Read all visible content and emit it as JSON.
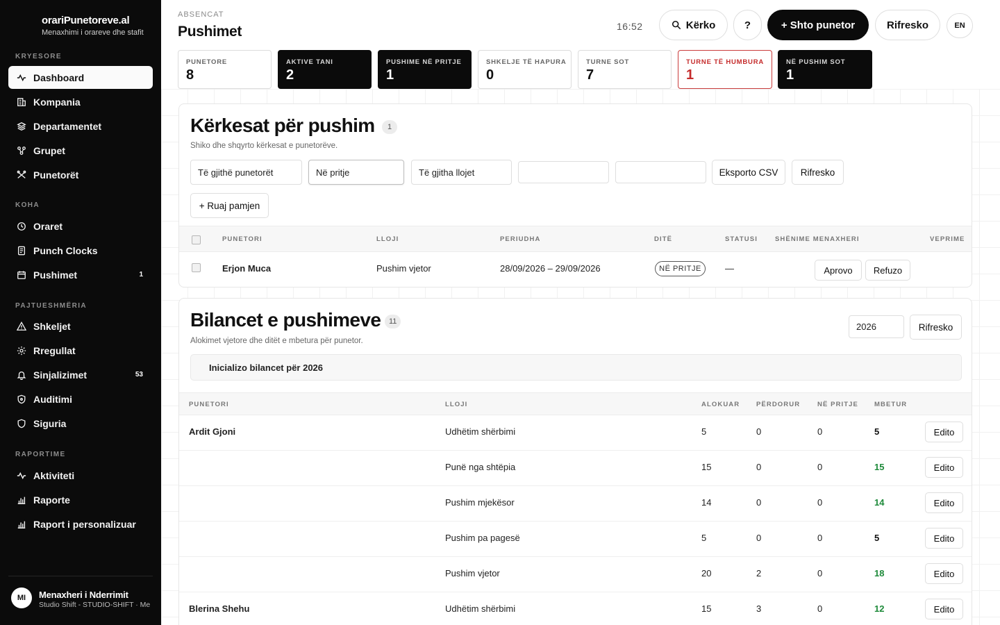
{
  "brand": {
    "title": "orariPunetoreve.al",
    "subtitle": "Menaxhimi i orareve dhe stafit"
  },
  "sidebar": {
    "sections": {
      "main": "KRYESORE",
      "time": "KOHA",
      "compliance": "PAJTUESHMËRIA",
      "reports": "RAPORTIME"
    },
    "items": [
      {
        "label": "Dashboard",
        "icon": "activity-icon",
        "active": true
      },
      {
        "label": "Kompania",
        "icon": "building-icon"
      },
      {
        "label": "Departamentet",
        "icon": "layers-icon"
      },
      {
        "label": "Grupet",
        "icon": "network-icon"
      },
      {
        "label": "Punetorët",
        "icon": "users-icon"
      },
      {
        "label": "Oraret",
        "icon": "clock-icon"
      },
      {
        "label": "Punch Clocks",
        "icon": "device-icon"
      },
      {
        "label": "Pushimet",
        "icon": "calendar-icon",
        "badge": "1"
      },
      {
        "label": "Shkeljet",
        "icon": "warning-icon"
      },
      {
        "label": "Rregullat",
        "icon": "gear-icon"
      },
      {
        "label": "Sinjalizimet",
        "icon": "bell-icon",
        "badge": "53"
      },
      {
        "label": "Auditimi",
        "icon": "shield-icon"
      },
      {
        "label": "Siguria",
        "icon": "shield-check-icon"
      },
      {
        "label": "Aktiviteti",
        "icon": "activity-icon"
      },
      {
        "label": "Raporte",
        "icon": "bar-chart-icon"
      },
      {
        "label": "Raport i personalizuar",
        "icon": "bar-chart-icon"
      }
    ]
  },
  "user": {
    "initials": "MI",
    "name": "Menaxheri i Nderrimit",
    "org": "Studio Shift - STUDIO-SHIFT · Me"
  },
  "header": {
    "eyebrow": "ABSENCAT",
    "title": "Pushimet",
    "clock": "16:52",
    "search_label": "Kërko",
    "help_label": "?",
    "add_label": "+ Shto punetor",
    "refresh_label": "Rifresko",
    "lang_label": "EN"
  },
  "stats": [
    {
      "label": "PUNETORE",
      "value": "8",
      "style": "light"
    },
    {
      "label": "AKTIVE TANI",
      "value": "2",
      "style": "dark"
    },
    {
      "label": "PUSHIME NË PRITJE",
      "value": "1",
      "style": "dark"
    },
    {
      "label": "SHKELJE TË HAPURA",
      "value": "0",
      "style": "light"
    },
    {
      "label": "TURNE SOT",
      "value": "7",
      "style": "light"
    },
    {
      "label": "TURNE TË HUMBURA",
      "value": "1",
      "style": "red"
    },
    {
      "label": "NË PUSHIM SOT",
      "value": "1",
      "style": "dark"
    }
  ],
  "requests": {
    "title": "Kërkesat për pushim",
    "count": "1",
    "subtitle": "Shiko dhe shqyrto kërkesat e punetorëve.",
    "filters": {
      "employee": "Të gjithë punetorët",
      "status": "Në pritje",
      "type": "Të gjitha llojet",
      "date_from": "",
      "date_to": ""
    },
    "export_label": "Eksporto CSV",
    "refresh_label": "Rifresko",
    "save_view_label": "+ Ruaj pamjen",
    "columns": [
      "PUNETORI",
      "LLOJI",
      "PERIUDHA",
      "DITË",
      "STATUSI",
      "SHËNIME MENAXHERI",
      "VEPRIME"
    ],
    "rows": [
      {
        "employee": "Erjon Muca",
        "type": "Pushim vjetor",
        "period": "28/09/2026 – 29/09/2026",
        "days": "",
        "status": "NË PRITJE",
        "notes": "—",
        "approve_label": "Aprovo",
        "reject_label": "Refuzo"
      }
    ]
  },
  "balances": {
    "title": "Bilancet e pushimeve",
    "count": "11",
    "subtitle": "Alokimet vjetore dhe ditët e mbetura për punetor.",
    "year": "2026",
    "refresh_label": "Rifresko",
    "init_label": "Inicializo bilancet për 2026",
    "columns": [
      "PUNETORI",
      "LLOJI",
      "ALOKUAR",
      "PËRDORUR",
      "NË PRITJE",
      "MBETUR"
    ],
    "edit_label": "Edito",
    "rows": [
      {
        "employee": "Ardit Gjoni",
        "type": "Udhëtim shërbimi",
        "allocated": "5",
        "used": "0",
        "pending": "0",
        "remaining": "5",
        "remaining_style": "plain"
      },
      {
        "employee": "",
        "type": "Punë nga shtëpia",
        "allocated": "15",
        "used": "0",
        "pending": "0",
        "remaining": "15",
        "remaining_style": "green"
      },
      {
        "employee": "",
        "type": "Pushim mjekësor",
        "allocated": "14",
        "used": "0",
        "pending": "0",
        "remaining": "14",
        "remaining_style": "green"
      },
      {
        "employee": "",
        "type": "Pushim pa pagesë",
        "allocated": "5",
        "used": "0",
        "pending": "0",
        "remaining": "5",
        "remaining_style": "plain"
      },
      {
        "employee": "",
        "type": "Pushim vjetor",
        "allocated": "20",
        "used": "2",
        "pending": "0",
        "remaining": "18",
        "remaining_style": "green"
      },
      {
        "employee": "Blerina Shehu",
        "type": "Udhëtim shërbimi",
        "allocated": "15",
        "used": "3",
        "pending": "0",
        "remaining": "12",
        "remaining_style": "green"
      }
    ]
  },
  "colors": {
    "accent_dark": "#0b0b0b",
    "danger": "#c52b2b",
    "success": "#1e8a3a"
  }
}
